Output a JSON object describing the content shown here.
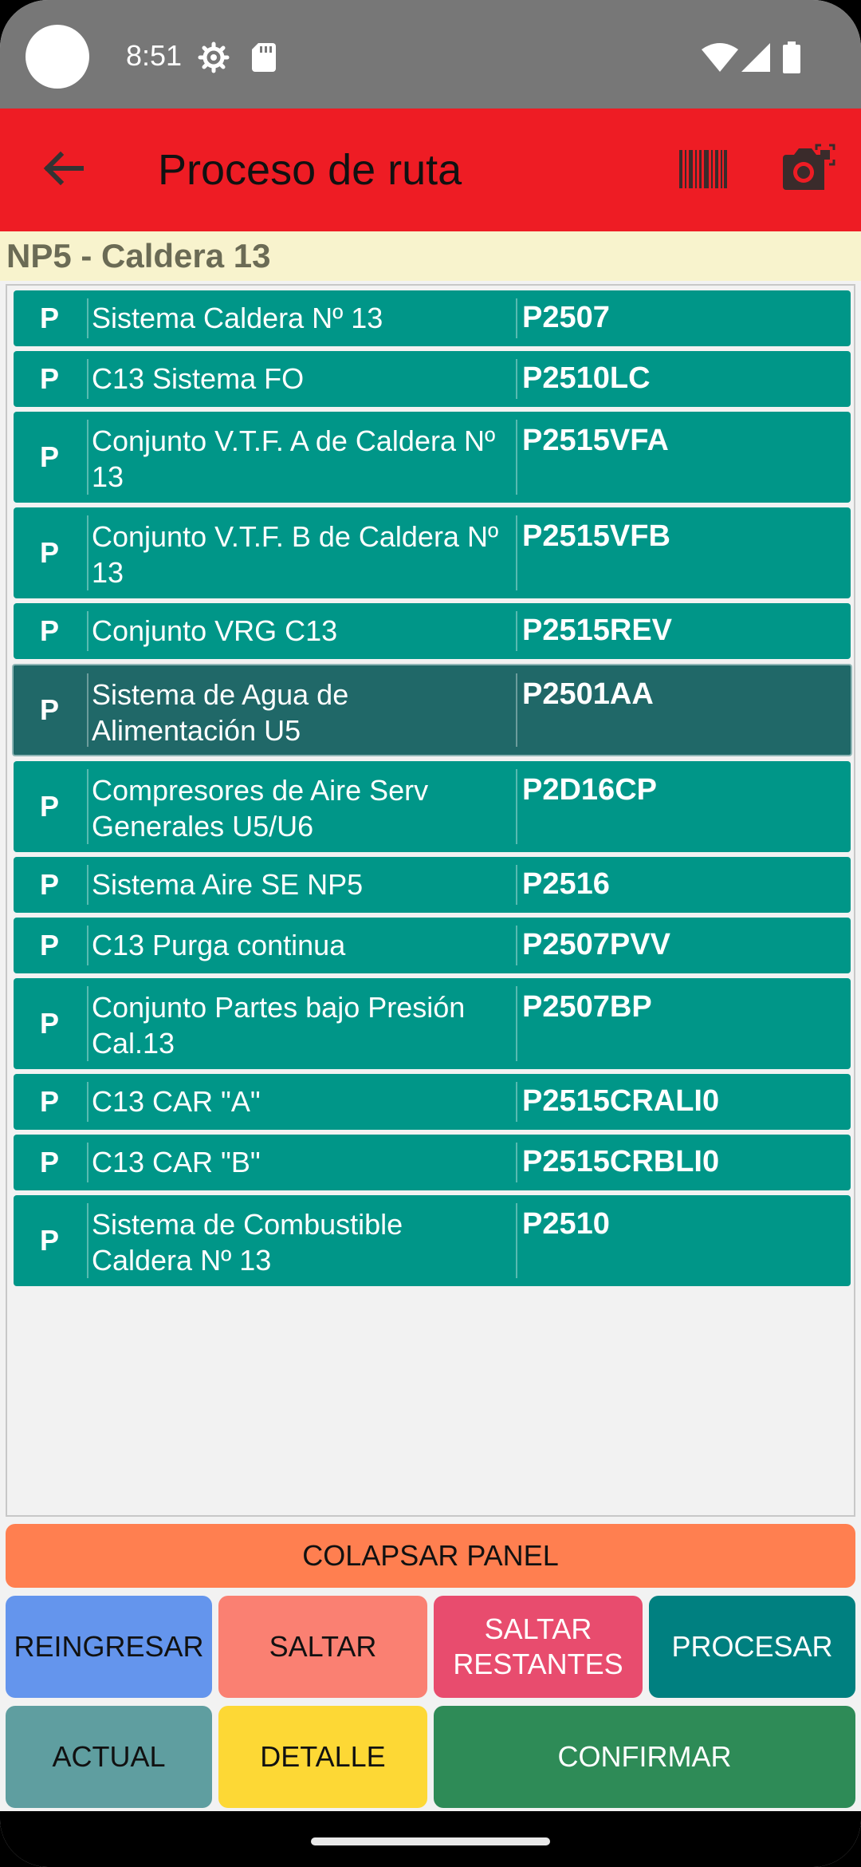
{
  "status_bar": {
    "time": "8:51",
    "icons": [
      "settings-icon",
      "sd-card-icon",
      "wifi-icon",
      "cell-signal-icon",
      "battery-icon"
    ]
  },
  "app_bar": {
    "title": "Proceso de ruta",
    "back_icon": "arrow-left-icon",
    "barcode_icon": "barcode-icon",
    "camera_icon": "camera-icon",
    "color": "#ee1c24"
  },
  "route": {
    "header": "NP5 - Caldera 13"
  },
  "list": {
    "items": [
      {
        "status": "P",
        "name": "Sistema Caldera Nº 13",
        "code": "P2507"
      },
      {
        "status": "P",
        "name": "C13 Sistema FO",
        "code": "P2510LC"
      },
      {
        "status": "P",
        "name": "Conjunto V.T.F. A de Caldera Nº 13",
        "code": "P2515VFA"
      },
      {
        "status": "P",
        "name": "Conjunto V.T.F. B de Caldera Nº 13",
        "code": "P2515VFB"
      },
      {
        "status": "P",
        "name": "Conjunto VRG C13",
        "code": "P2515REV"
      },
      {
        "status": "P",
        "name": "Sistema de Agua de Alimentación U5",
        "code": "P2501AA"
      },
      {
        "status": "P",
        "name": "Compresores de Aire Serv Generales U5/U6",
        "code": "P2D16CP"
      },
      {
        "status": "P",
        "name": "Sistema Aire SE NP5",
        "code": "P2516"
      },
      {
        "status": "P",
        "name": "C13 Purga continua",
        "code": "P2507PVV"
      },
      {
        "status": "P",
        "name": "Conjunto Partes bajo Presión Cal.13",
        "code": "P2507BP"
      },
      {
        "status": "P",
        "name": "C13 CAR \"A\"",
        "code": "P2515CRALI0"
      },
      {
        "status": "P",
        "name": "C13 CAR \"B\"",
        "code": "P2515CRBLI0"
      },
      {
        "status": "P",
        "name": "Sistema de Combustible Caldera Nº 13",
        "code": "P2510"
      }
    ],
    "row_color": "#009688",
    "selected_color": "#206868"
  },
  "buttons": {
    "collapse": "COLAPSAR PANEL",
    "reingresar": "REINGRESAR",
    "saltar": "SALTAR",
    "saltar_restantes": "SALTAR RESTANTES",
    "procesar": "PROCESAR",
    "actual": "ACTUAL",
    "detalle": "DETALLE",
    "confirmar": "CONFIRMAR"
  }
}
